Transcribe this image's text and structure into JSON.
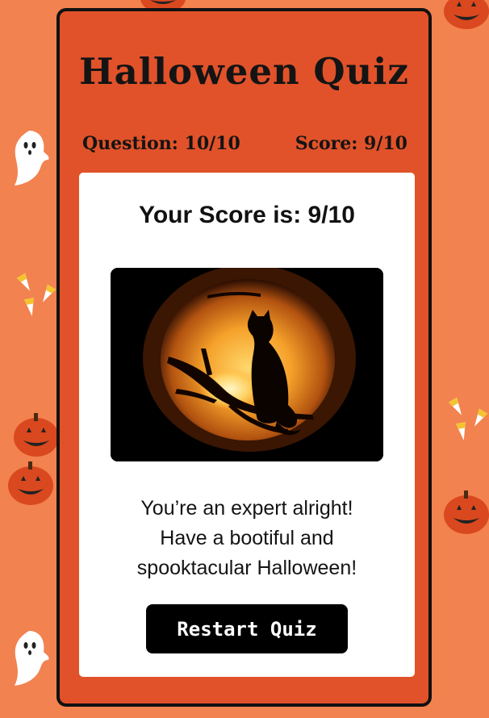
{
  "quiz": {
    "title": "Halloween Quiz",
    "question_label": "Question: 10/10",
    "score_label": "Score: 9/10"
  },
  "result": {
    "heading": "Your Score is: 9/10",
    "image_icon": "jack-o-lantern-cat-icon",
    "message_line1": "You’re an expert alright!",
    "message_line2": "Have a bootiful and",
    "message_line3": "spooktacular Halloween!",
    "restart_label": "Restart Quiz"
  },
  "colors": {
    "page_background": "#f2824f",
    "card_background": "#e1522a",
    "panel_background": "#ffffff",
    "button_background": "#000000",
    "text": "#141414"
  }
}
